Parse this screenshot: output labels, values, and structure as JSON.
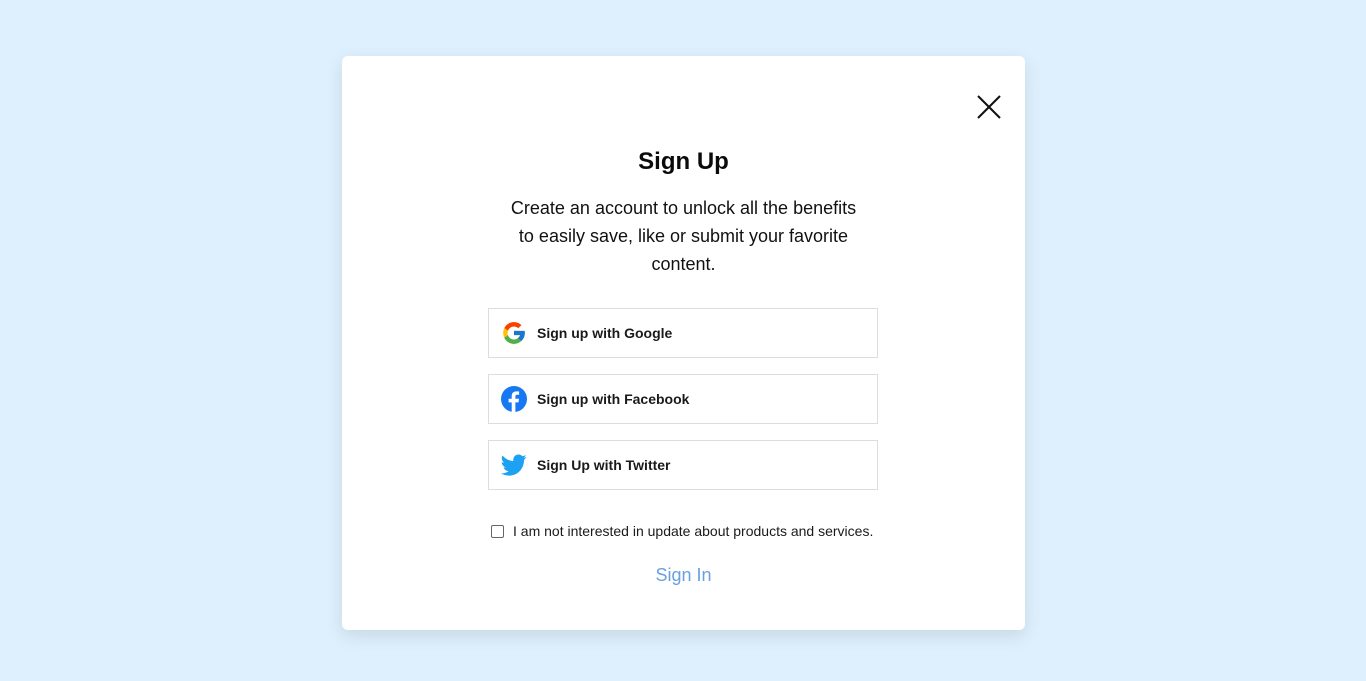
{
  "modal": {
    "title": "Sign Up",
    "subtitle": "Create an account to unlock all the benefits to easily save, like or submit your favorite content.",
    "close_icon": "close-icon"
  },
  "social_buttons": [
    {
      "label": "Sign up with Google",
      "icon": "google-icon"
    },
    {
      "label": "Sign up with Facebook",
      "icon": "facebook-icon",
      "color": "#1877f2"
    },
    {
      "label": "Sign Up with Twitter",
      "icon": "twitter-icon",
      "color": "#1da1f2"
    }
  ],
  "optout": {
    "label": "I am not interested in update about products and services.",
    "checked": false
  },
  "signin": {
    "label": "Sign In",
    "color": "#6aa0de"
  },
  "colors": {
    "background": "#def0fd",
    "modal": "#ffffff"
  }
}
